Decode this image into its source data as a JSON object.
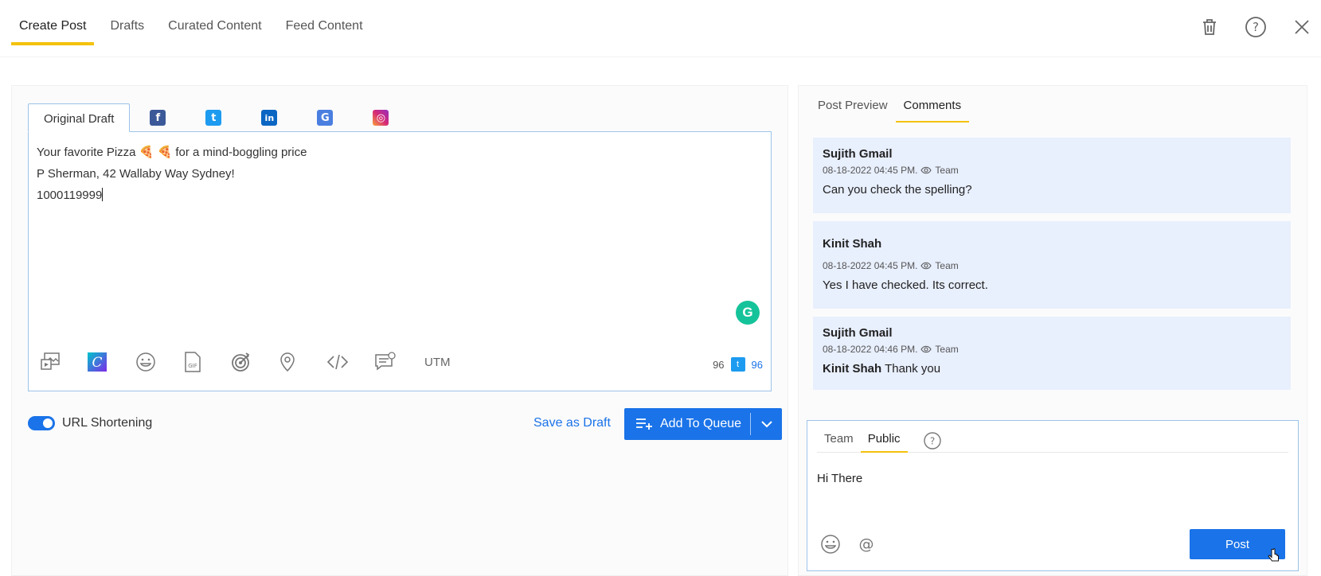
{
  "top_tabs": [
    {
      "label": "Create Post",
      "active": true
    },
    {
      "label": "Drafts",
      "active": false
    },
    {
      "label": "Curated Content",
      "active": false
    },
    {
      "label": "Feed Content",
      "active": false
    }
  ],
  "top_icons": [
    "trash-icon",
    "help-icon",
    "close-icon"
  ],
  "composer": {
    "active_tab": "Original Draft",
    "networks": [
      {
        "name": "facebook-icon",
        "color": "#3b5998",
        "glyph": "f"
      },
      {
        "name": "twitter-icon",
        "color": "#1d9bf0",
        "glyph": "t"
      },
      {
        "name": "linkedin-icon",
        "color": "#0a66c2",
        "glyph": "in"
      },
      {
        "name": "google-business-icon",
        "color": "#4a7fe0",
        "glyph": "G"
      },
      {
        "name": "instagram-icon",
        "color": "#d62976",
        "glyph": "◎"
      }
    ],
    "lines": [
      {
        "before": "Your favorite Pizza ",
        "emoji": "🍕 🍕",
        "after": " for a mind-boggling price"
      },
      {
        "text": "P Sherman, 42 Wallaby Way Sydney!"
      },
      {
        "text": "1000119999"
      }
    ],
    "grammarly_glyph": "G",
    "toolbar_icons": [
      "media-icon",
      "canva-icon",
      "emoji-icon",
      "gif-icon",
      "target-icon",
      "location-icon",
      "code-icon",
      "comment-settings-icon"
    ],
    "utm_label": "UTM",
    "char_count": "96",
    "twitter_count": "96"
  },
  "actions": {
    "url_shortening_label": "URL Shortening",
    "url_shortening_on": true,
    "save_draft_label": "Save as Draft",
    "add_queue_label": "Add To Queue"
  },
  "right": {
    "tabs": [
      {
        "label": "Post Preview",
        "active": false
      },
      {
        "label": "Comments",
        "active": true
      }
    ],
    "comments": [
      {
        "author": "Sujith Gmail",
        "meta": "08-18-2022 04:45 PM.",
        "visibility": "Team",
        "mention": "",
        "body": "Can you check the spelling?"
      },
      {
        "author": "Kinit Shah",
        "meta": "08-18-2022 04:45 PM.",
        "visibility": "Team",
        "mention": "",
        "body": "Yes I have checked. Its correct."
      },
      {
        "author": "Sujith Gmail",
        "meta": "08-18-2022 04:46 PM.",
        "visibility": "Team",
        "mention": "Kinit Shah",
        "body": " Thank you"
      }
    ],
    "reply": {
      "tabs": [
        {
          "label": "Team",
          "active": false
        },
        {
          "label": "Public",
          "active": true
        }
      ],
      "text": "Hi There",
      "post_label": "Post"
    }
  }
}
